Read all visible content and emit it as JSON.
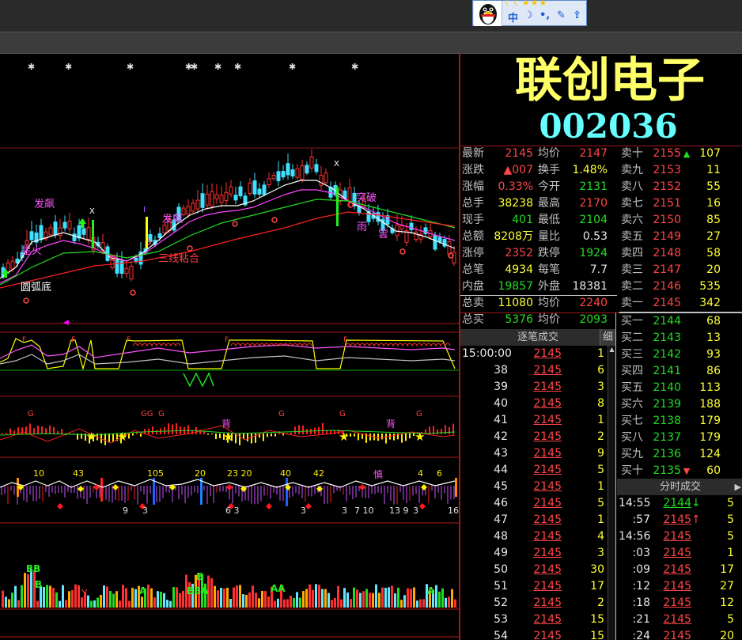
{
  "stock": {
    "name": "联创电子",
    "code": "002036"
  },
  "qq": {
    "stars": "☾☾★★★",
    "b1": "中",
    "b2": "☽",
    "b3": "•,",
    "b4": "✎",
    "b5": "⇪"
  },
  "quote": [
    {
      "label": "最新",
      "value": "2145",
      "label2": "均价",
      "value2": "2147"
    },
    {
      "label": "涨跌",
      "value": "▲007",
      "label2": "换手",
      "value2": "1.48%"
    },
    {
      "label": "涨幅",
      "value": "0.33%",
      "label2": "今开",
      "value2": "2131"
    },
    {
      "label": "总手",
      "value": "38238",
      "label2": "最高",
      "value2": "2170"
    },
    {
      "label": "现手",
      "value": "401",
      "label2": "最低",
      "value2": "2104"
    },
    {
      "label": "总额",
      "value": "8208万",
      "label2": "量比",
      "value2": "0.53"
    },
    {
      "label": "涨停",
      "value": "2352",
      "label2": "跌停",
      "value2": "1924"
    },
    {
      "label": "总笔",
      "value": "4934",
      "label2": "每笔",
      "value2": "7.7"
    },
    {
      "label": "内盘",
      "value": "19857",
      "label2": "外盘",
      "value2": "18381"
    },
    {
      "label": "总卖",
      "value": "11080",
      "label2": "均价",
      "value2": "2240"
    },
    {
      "label": "总买",
      "value": "5376",
      "label2": "均价",
      "value2": "2093"
    }
  ],
  "sell": [
    {
      "label": "卖十",
      "price": "2155",
      "vol": "107",
      "arrow": "▲"
    },
    {
      "label": "卖九",
      "price": "2153",
      "vol": "11",
      "arrow": ""
    },
    {
      "label": "卖八",
      "price": "2152",
      "vol": "55",
      "arrow": ""
    },
    {
      "label": "卖七",
      "price": "2151",
      "vol": "16",
      "arrow": ""
    },
    {
      "label": "卖六",
      "price": "2150",
      "vol": "85",
      "arrow": ""
    },
    {
      "label": "卖五",
      "price": "2149",
      "vol": "27",
      "arrow": ""
    },
    {
      "label": "卖四",
      "price": "2148",
      "vol": "58",
      "arrow": ""
    },
    {
      "label": "卖三",
      "price": "2147",
      "vol": "20",
      "arrow": ""
    },
    {
      "label": "卖二",
      "price": "2146",
      "vol": "535",
      "arrow": ""
    },
    {
      "label": "卖一",
      "price": "2145",
      "vol": "342",
      "arrow": ""
    }
  ],
  "buy": [
    {
      "label": "买一",
      "price": "2144",
      "vol": "68",
      "arrow": ""
    },
    {
      "label": "买二",
      "price": "2143",
      "vol": "13",
      "arrow": ""
    },
    {
      "label": "买三",
      "price": "2142",
      "vol": "93",
      "arrow": ""
    },
    {
      "label": "买四",
      "price": "2141",
      "vol": "86",
      "arrow": ""
    },
    {
      "label": "买五",
      "price": "2140",
      "vol": "113",
      "arrow": ""
    },
    {
      "label": "买六",
      "price": "2139",
      "vol": "188",
      "arrow": ""
    },
    {
      "label": "买七",
      "price": "2138",
      "vol": "179",
      "arrow": ""
    },
    {
      "label": "买八",
      "price": "2137",
      "vol": "179",
      "arrow": ""
    },
    {
      "label": "买九",
      "price": "2136",
      "vol": "124",
      "arrow": ""
    },
    {
      "label": "买十",
      "price": "2135",
      "vol": "60",
      "arrow": "▼"
    }
  ],
  "ticks_head": {
    "title": "逐笔成交",
    "detail": "细"
  },
  "ticks": [
    {
      "t": "15:00:00",
      "p": "2145",
      "v": "1"
    },
    {
      "t": "38",
      "p": "2145",
      "v": "6"
    },
    {
      "t": "39",
      "p": "2145",
      "v": "3"
    },
    {
      "t": "40",
      "p": "2145",
      "v": "8"
    },
    {
      "t": "41",
      "p": "2145",
      "v": "1"
    },
    {
      "t": "42",
      "p": "2145",
      "v": "2"
    },
    {
      "t": "43",
      "p": "2145",
      "v": "9"
    },
    {
      "t": "44",
      "p": "2145",
      "v": "5"
    },
    {
      "t": "45",
      "p": "2145",
      "v": "1"
    },
    {
      "t": "46",
      "p": "2145",
      "v": "5"
    },
    {
      "t": "47",
      "p": "2145",
      "v": "1"
    },
    {
      "t": "48",
      "p": "2145",
      "v": "4"
    },
    {
      "t": "49",
      "p": "2145",
      "v": "3"
    },
    {
      "t": "50",
      "p": "2145",
      "v": "30"
    },
    {
      "t": "51",
      "p": "2145",
      "v": "17"
    },
    {
      "t": "52",
      "p": "2145",
      "v": "2"
    },
    {
      "t": "53",
      "p": "2145",
      "v": "15"
    },
    {
      "t": "54",
      "p": "2145",
      "v": "15"
    }
  ],
  "minute_head": {
    "title": "分时成交",
    "arrow": "▶"
  },
  "minute": [
    {
      "t": "14:55",
      "p": "2144",
      "a": "↓",
      "v": "5"
    },
    {
      "t": ":57",
      "p": "2145",
      "a": "↑",
      "v": "5"
    },
    {
      "t": "14:56",
      "p": "2145",
      "a": "",
      "v": "5"
    },
    {
      "t": ":03",
      "p": "2145",
      "a": "",
      "v": "1"
    },
    {
      "t": ":09",
      "p": "2145",
      "a": "",
      "v": "17"
    },
    {
      "t": ":12",
      "p": "2145",
      "a": "",
      "v": "27"
    },
    {
      "t": ":18",
      "p": "2145",
      "a": "",
      "v": "12"
    },
    {
      "t": ":21",
      "p": "2145",
      "a": "",
      "v": "5"
    },
    {
      "t": ":24",
      "p": "2145",
      "a": "",
      "v": "20"
    }
  ],
  "chart_labels": {
    "fapiao1": "发飙",
    "fapiao2": "发飙",
    "xinghuo": "星火",
    "yuanhudi": "圆弧底",
    "sanxian": "三线粘合",
    "tuipo": "突破",
    "yu": "雨",
    "yun": "雲",
    "x1": "X",
    "x2": "X",
    "i1": "I",
    "g": "G",
    "gg": "GG",
    "bei": "背",
    "shen": "慎",
    "n10": "10",
    "n43": "43",
    "n105": "105",
    "n20": "20",
    "n2320": "23 20",
    "n40": "40",
    "n42": "42",
    "n4": "4",
    "n6": "6",
    "b9": "9",
    "b3": "3",
    "b63": "6 3",
    "b3b": "3",
    "b3c": "3",
    "b710": "7 10",
    "b139": "13 9",
    "b3d": "3",
    "b16": "16",
    "v_bb": "BB",
    "v_b": "B",
    "v_bba": "BBA",
    "v_aa": "AA",
    "v_a": "A",
    "v_y": "Y",
    "v_aaa": "A"
  }
}
